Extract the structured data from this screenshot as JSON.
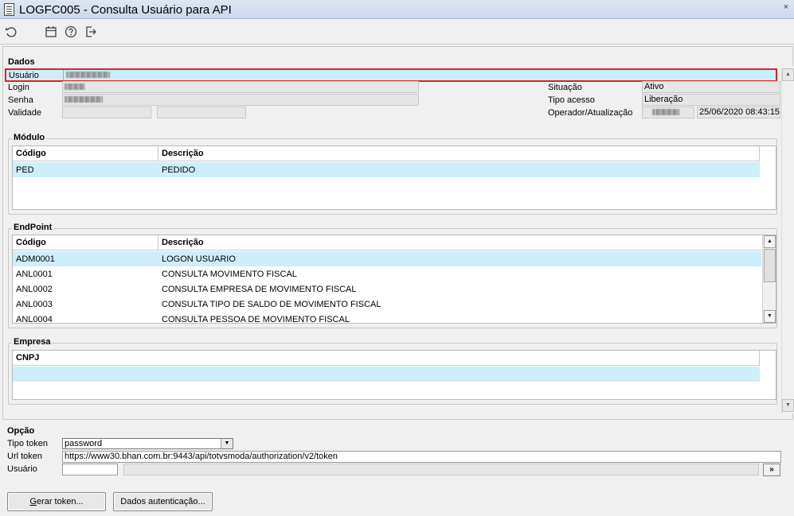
{
  "window": {
    "title": "LOGFC005 - Consulta Usuário para API",
    "close_glyph": "×"
  },
  "toolbar": {
    "icons": [
      "refresh-icon",
      "calendar-icon",
      "help-icon",
      "exit-icon"
    ]
  },
  "dados": {
    "section_label": "Dados",
    "usuario_label": "Usuário",
    "login_label": "Login",
    "senha_label": "Senha",
    "validade_label": "Validade",
    "situacao_label": "Situação",
    "situacao_value": "Ativo",
    "tipo_acesso_label": "Tipo acesso",
    "tipo_acesso_value": "Liberação",
    "operador_label": "Operador/Atualização",
    "atualizacao_value": "25/06/2020 08:43:15"
  },
  "modulo": {
    "label": "Módulo",
    "columns": [
      "Código",
      "Descrição"
    ],
    "rows": [
      {
        "codigo": "PED",
        "descricao": "PEDIDO"
      }
    ]
  },
  "endpoint": {
    "label": "EndPoint",
    "columns": [
      "Código",
      "Descrição"
    ],
    "rows": [
      {
        "codigo": "ADM0001",
        "descricao": "LOGON USUARIO"
      },
      {
        "codigo": "ANL0001",
        "descricao": "CONSULTA MOVIMENTO FISCAL"
      },
      {
        "codigo": "ANL0002",
        "descricao": "CONSULTA EMPRESA DE MOVIMENTO FISCAL"
      },
      {
        "codigo": "ANL0003",
        "descricao": "CONSULTA TIPO DE SALDO DE MOVIMENTO FISCAL"
      },
      {
        "codigo": "ANL0004",
        "descricao": "CONSULTA PESSOA DE MOVIMENTO FISCAL"
      }
    ]
  },
  "empresa": {
    "label": "Empresa",
    "columns": [
      "CNPJ"
    ]
  },
  "opcao": {
    "label": "Opção",
    "tipo_token_label": "Tipo token",
    "tipo_token_value": "password",
    "url_token_label": "Url token",
    "url_token_value": "https://www30.bhan.com.br:9443/api/totvsmoda/authorization/v2/token",
    "usuario_label": "Usuário",
    "search_button": "»"
  },
  "buttons": {
    "gerar_token_prefix": "G",
    "gerar_token_rest": "erar token...",
    "dados_auth_label": "Dados autenticação..."
  }
}
